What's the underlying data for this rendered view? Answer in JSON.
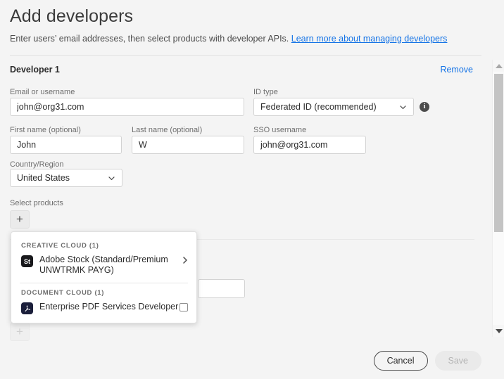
{
  "header": {
    "title": "Add developers",
    "subtitle_text": "Enter users’ email addresses, then select products with developer APIs.",
    "link_text": "Learn more about managing developers",
    "link_color": "#1473e6"
  },
  "developer": {
    "section_label": "Developer 1",
    "remove_label": "Remove",
    "fields": {
      "email": {
        "label": "Email or username",
        "value": "john@org31.com",
        "placeholder": ""
      },
      "id_type": {
        "label": "ID type",
        "value": "Federated ID (recommended)",
        "chevron_icon": "chevron-down-icon",
        "info_icon": "info-icon",
        "info_glyph": "i"
      },
      "first_name": {
        "label": "First name (optional)",
        "value": "John",
        "placeholder": ""
      },
      "last_name": {
        "label": "Last name (optional)",
        "value": "W",
        "placeholder": ""
      },
      "sso_username": {
        "label": "SSO username",
        "value": "john@org31.com",
        "placeholder": ""
      },
      "country": {
        "label": "Country/Region",
        "value": "United States",
        "chevron_icon": "chevron-down-icon"
      }
    },
    "select_products": {
      "label": "Select products",
      "add_button_glyph": "+"
    }
  },
  "product_popup": {
    "groups": [
      {
        "header": "CREATIVE CLOUD (1)",
        "items": [
          {
            "name": "Adobe Stock (Standard/Premium UNWTRMK PAYG)",
            "icon_name": "adobe-stock-icon",
            "icon_text": "St",
            "icon_color": "#19191c",
            "trailing": "chevron-right-icon"
          }
        ]
      },
      {
        "header": "DOCUMENT CLOUD (1)",
        "items": [
          {
            "name": "Enterprise PDF Services Developer",
            "icon_name": "adobe-acrobat-icon",
            "icon_text": "A",
            "icon_color": "#1b1f3b",
            "trailing": "checkbox",
            "checked": false
          }
        ]
      }
    ]
  },
  "second_developer": {
    "add_button_glyph": "+"
  },
  "footer": {
    "cancel_label": "Cancel",
    "save_label": "Save",
    "save_disabled": true
  },
  "scrollbar": {
    "up_arrow_icon": "triangle-up-icon",
    "down_arrow_icon": "triangle-down-icon"
  }
}
